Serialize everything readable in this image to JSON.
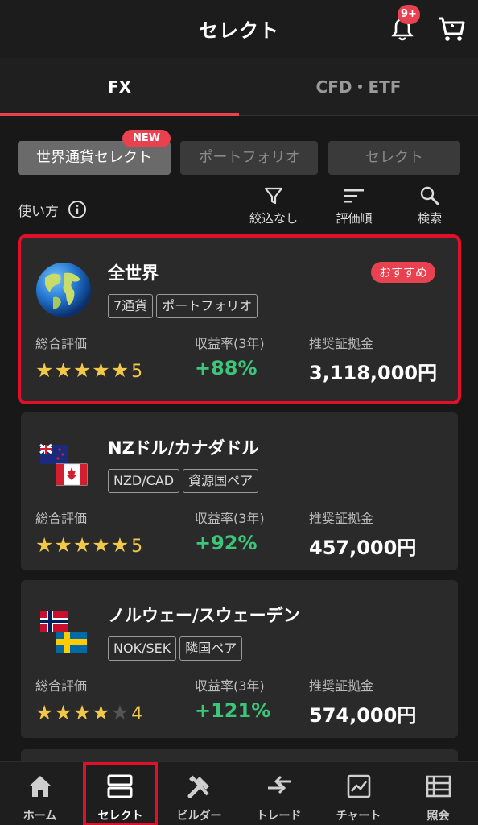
{
  "header": {
    "title": "セレクト",
    "notification_badge": "9+"
  },
  "tabs": [
    {
      "label": "FX",
      "active": true
    },
    {
      "label": "CFD・ETF",
      "active": false
    }
  ],
  "chips": [
    {
      "label": "世界通貨セレクト",
      "selected": true,
      "badge": "NEW"
    },
    {
      "label": "ポートフォリオ",
      "selected": false
    },
    {
      "label": "セレクト",
      "selected": false
    }
  ],
  "toolbar": {
    "howto": "使い方",
    "filter": "絞込なし",
    "sort": "評価順",
    "search": "検索"
  },
  "labels": {
    "rating": "総合評価",
    "return": "収益率(3年)",
    "margin": "推奨証拠金"
  },
  "cards": [
    {
      "name": "全世界",
      "tags": [
        "7通貨",
        "ポートフォリオ"
      ],
      "badge": "おすすめ",
      "rating": 5,
      "rating_text": "5",
      "return": "+88%",
      "margin": "3,118,000円",
      "icon": "globe-icon"
    },
    {
      "name": "NZドル/カナダドル",
      "tags": [
        "NZD/CAD",
        "資源国ペア"
      ],
      "rating": 5,
      "rating_text": "5",
      "return": "+92%",
      "margin": "457,000円",
      "icon": "nz-ca-flag-icon"
    },
    {
      "name": "ノルウェー/スウェーデン",
      "tags": [
        "NOK/SEK",
        "隣国ペア"
      ],
      "rating": 4,
      "rating_text": "4",
      "return": "+121%",
      "margin": "574,000円",
      "icon": "no-se-flag-icon"
    }
  ],
  "tabbar": [
    {
      "label": "ホーム",
      "icon": "home-icon"
    },
    {
      "label": "セレクト",
      "icon": "select-icon",
      "selected": true
    },
    {
      "label": "ビルダー",
      "icon": "builder-icon"
    },
    {
      "label": "トレード",
      "icon": "trade-icon"
    },
    {
      "label": "チャート",
      "icon": "chart-icon"
    },
    {
      "label": "照会",
      "icon": "list-icon"
    }
  ],
  "colors": {
    "accent": "#e8414f",
    "positive": "#3cc67a",
    "star": "#f1c84a",
    "background": "#181818"
  }
}
